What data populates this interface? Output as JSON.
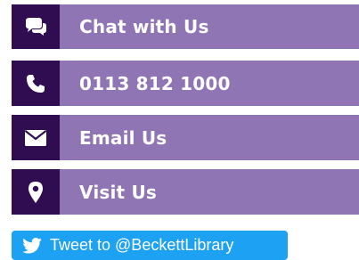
{
  "contacts": [
    {
      "label": "Chat with Us",
      "icon": "chat-icon"
    },
    {
      "label": "0113 812 1000",
      "icon": "phone-icon"
    },
    {
      "label": "Email Us",
      "icon": "envelope-icon"
    },
    {
      "label": "Visit Us",
      "icon": "map-marker-icon"
    }
  ],
  "tweet": {
    "label": "Tweet to @BeckettLibrary",
    "icon": "twitter-bird-icon"
  },
  "colors": {
    "icon_bg": "#2f0d50",
    "label_bg": "#8f75b3",
    "twitter_blue": "#1da1f2",
    "text": "#ffffff"
  }
}
